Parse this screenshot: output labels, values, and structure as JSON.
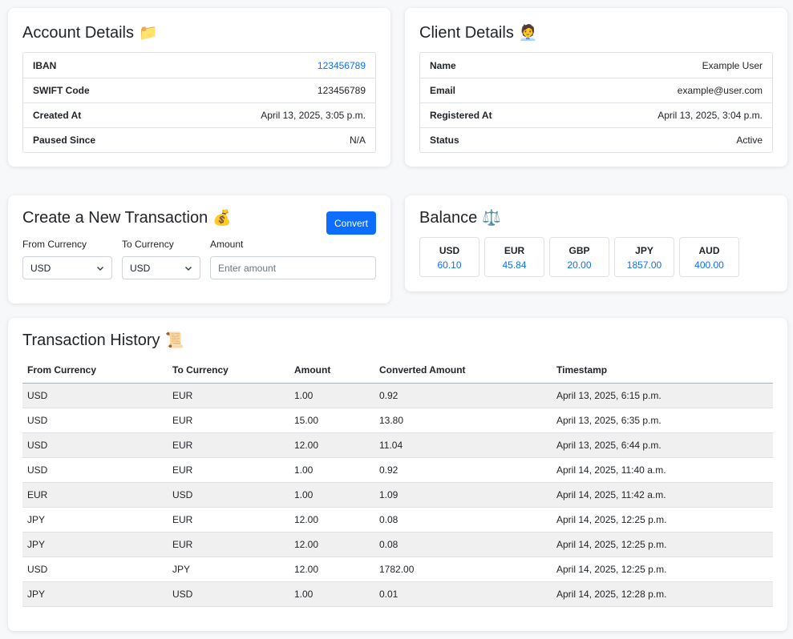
{
  "account": {
    "title": "Account Details",
    "icon": "folder-icon",
    "icon_glyph": "📁",
    "rows": [
      {
        "label": "IBAN",
        "value": "123456789"
      },
      {
        "label": "SWIFT Code",
        "value": "123456789"
      },
      {
        "label": "Created At",
        "value": "April 13, 2025, 3:05 p.m."
      },
      {
        "label": "Paused Since",
        "value": "N/A"
      }
    ]
  },
  "client": {
    "title": "Client Details",
    "icon": "person-office-worker-icon",
    "icon_glyph": "🧑‍💼",
    "rows": [
      {
        "label": "Name",
        "value": "Example User"
      },
      {
        "label": "Email",
        "value": "example@user.com"
      },
      {
        "label": "Registered At",
        "value": "April 13, 2025, 3:04 p.m."
      },
      {
        "label": "Status",
        "value": "Active"
      }
    ]
  },
  "transaction_form": {
    "title": "Create a New Transaction",
    "icon": "money-bag-icon",
    "icon_glyph": "💰",
    "convert_label": "Convert",
    "from_label": "From Currency",
    "from_value": "USD",
    "to_label": "To Currency",
    "to_value": "USD",
    "amount_label": "Amount",
    "amount_placeholder": "Enter amount"
  },
  "balance": {
    "title": "Balance",
    "icon": "scales-icon",
    "icon_glyph": "⚖️",
    "items": [
      {
        "currency": "USD",
        "amount": "60.10"
      },
      {
        "currency": "EUR",
        "amount": "45.84"
      },
      {
        "currency": "GBP",
        "amount": "20.00"
      },
      {
        "currency": "JPY",
        "amount": "1857.00"
      },
      {
        "currency": "AUD",
        "amount": "400.00"
      }
    ]
  },
  "history": {
    "title": "Transaction History",
    "icon": "scroll-icon",
    "icon_glyph": "📜",
    "columns": [
      "From Currency",
      "To Currency",
      "Amount",
      "Converted Amount",
      "Timestamp"
    ],
    "rows": [
      [
        "USD",
        "EUR",
        "1.00",
        "0.92",
        "April 13, 2025, 6:15 p.m."
      ],
      [
        "USD",
        "EUR",
        "15.00",
        "13.80",
        "April 13, 2025, 6:35 p.m."
      ],
      [
        "USD",
        "EUR",
        "12.00",
        "11.04",
        "April 13, 2025, 6:44 p.m."
      ],
      [
        "USD",
        "EUR",
        "1.00",
        "0.92",
        "April 14, 2025, 11:40 a.m."
      ],
      [
        "EUR",
        "USD",
        "1.00",
        "1.09",
        "April 14, 2025, 11:42 a.m."
      ],
      [
        "JPY",
        "EUR",
        "12.00",
        "0.08",
        "April 14, 2025, 12:25 p.m."
      ],
      [
        "JPY",
        "EUR",
        "12.00",
        "0.08",
        "April 14, 2025, 12:25 p.m."
      ],
      [
        "USD",
        "JPY",
        "12.00",
        "1782.00",
        "April 14, 2025, 12:25 p.m."
      ],
      [
        "JPY",
        "USD",
        "1.00",
        "0.01",
        "April 14, 2025, 12:28 p.m."
      ]
    ]
  },
  "colors": {
    "accent": "#0d6efd",
    "background": "#f7f8fa",
    "stripe": "#f0f0f0"
  }
}
